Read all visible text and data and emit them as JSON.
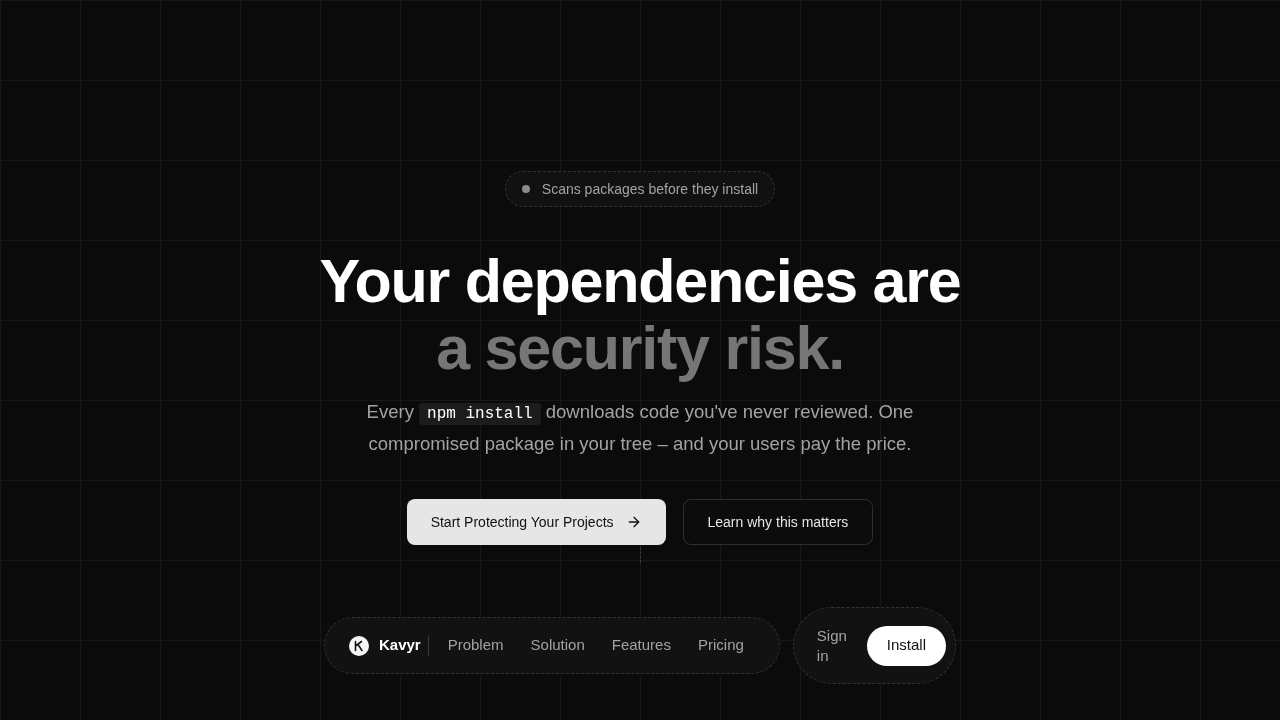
{
  "badge": {
    "text": "Scans packages before they install"
  },
  "headline": {
    "line_1": "Your dependencies are",
    "line_2": "a security risk."
  },
  "description": {
    "before_code": "Every",
    "code": "npm install",
    "after_code": "downloads code you've never reviewed. One compromised package in your tree – and your users pay the price."
  },
  "actions": [
    {
      "label": "Start Protecting Your Projects",
      "kind": "primary"
    },
    {
      "label": "Learn why this matters",
      "kind": "secondary"
    }
  ],
  "navbar": {
    "brand": "Kavyr",
    "links": [
      "Problem",
      "Solution",
      "Features",
      "Pricing"
    ],
    "sign_in": "Sign in",
    "install": "Install"
  }
}
